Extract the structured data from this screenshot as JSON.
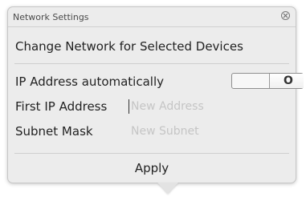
{
  "window": {
    "title": "Network Settings",
    "close_icon": "close-icon"
  },
  "panel": {
    "heading": "Change Network for Selected Devices",
    "rows": [
      {
        "label": "IP Address automatically",
        "toggle": {
          "value": "O"
        }
      },
      {
        "label": "First IP Address",
        "placeholder": "New Address"
      },
      {
        "label": "Subnet Mask",
        "placeholder": "New Subnet"
      }
    ]
  },
  "actions": {
    "apply_label": "Apply"
  }
}
